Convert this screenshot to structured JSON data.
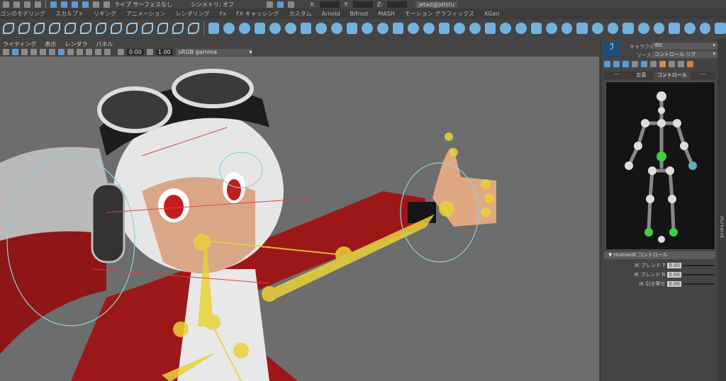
{
  "status_line": {
    "live_surface": "ライブ サーフェスなし",
    "symmetry": "シンメトリ: オフ",
    "x_label": "X:",
    "y_label": "Y:",
    "z_label": "Z:",
    "user": "jetad@jetstu"
  },
  "shelf_tabs": [
    "ゴンのモデリング",
    "スカルプト",
    "リギング",
    "アニメーション",
    "レンダリング",
    "Fx",
    "FX キャッシング",
    "カスタム",
    "Arnold",
    "Bifrost",
    "MASH",
    "モーション グラフィックス",
    "XGen"
  ],
  "panel_menu": [
    "ライティング",
    "表示",
    "レンダラ",
    "パネル"
  ],
  "panel_toolbar": {
    "exposure": "0.00",
    "gamma": "1.00",
    "color_space": "sRGB gamma"
  },
  "humanik": {
    "character_label": "キャラクタ:",
    "character_value": "IEK",
    "source_label": "ソース:",
    "source_value": "コントロール リグ",
    "tabs": [
      "---",
      "定義",
      "コントロール",
      "---"
    ],
    "active_tab": "コントロール",
    "section_title": "HumanIK コントロール",
    "sliders": [
      {
        "label": "IK ブレンド T",
        "value": "0.00"
      },
      {
        "label": "IK ブレンド R",
        "value": "0.00"
      },
      {
        "label": "IK 引き寄せ",
        "value": "0.00"
      }
    ]
  },
  "side_tabs": [
    "HumanIK"
  ],
  "colors": {
    "accent": "#5b9bd5",
    "viewport_bg": "#6d6d6d",
    "rig_yellow": "#e8d23a",
    "effector_green": "#3fd13f"
  }
}
